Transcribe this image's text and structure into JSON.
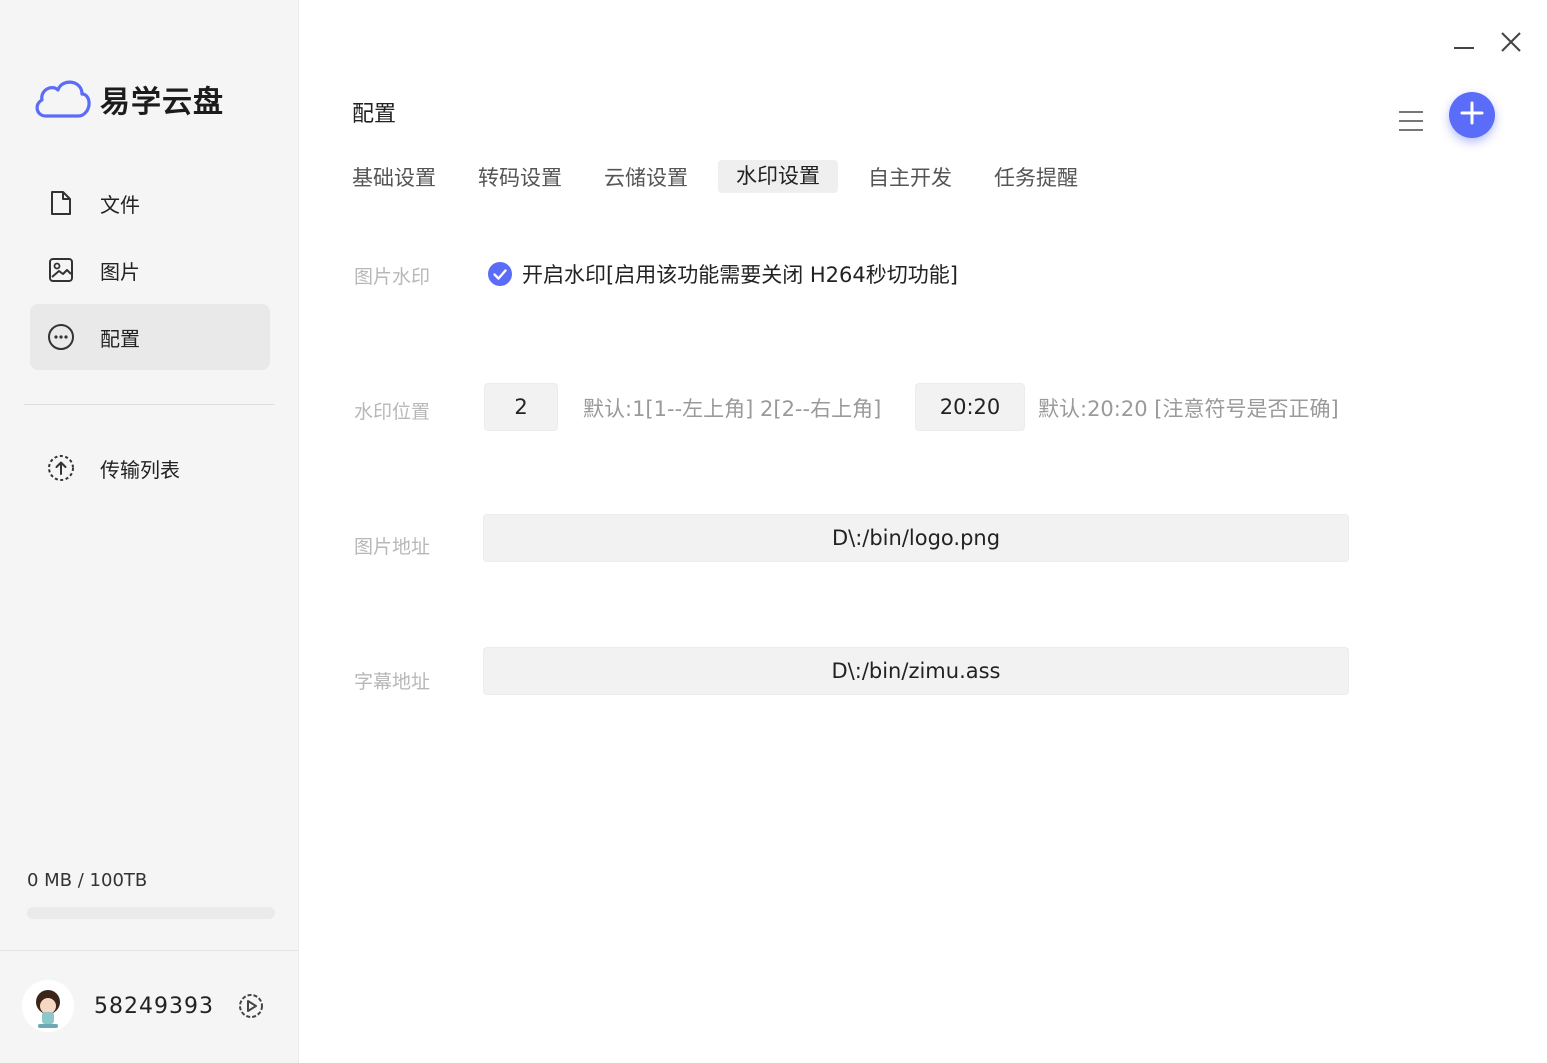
{
  "app": {
    "name": "易学云盘"
  },
  "sidebar": {
    "items": [
      {
        "label": "文件",
        "icon": "file-icon"
      },
      {
        "label": "图片",
        "icon": "image-icon"
      },
      {
        "label": "配置",
        "icon": "more-circle-icon",
        "active": true
      },
      {
        "label": "传输列表",
        "icon": "upload-circle-icon"
      }
    ],
    "storage": {
      "text": "0 MB / 100TB",
      "used_fraction": 0
    },
    "user": {
      "id": "58249393"
    }
  },
  "header": {
    "title": "配置"
  },
  "tabs": [
    {
      "label": "基础设置"
    },
    {
      "label": "转码设置"
    },
    {
      "label": "云储设置"
    },
    {
      "label": "水印设置",
      "active": true
    },
    {
      "label": "自主开发"
    },
    {
      "label": "任务提醒"
    }
  ],
  "watermark": {
    "enable": {
      "label": "图片水印",
      "checked": true,
      "text": "开启水印[启用该功能需要关闭 H264秒切功能]"
    },
    "position": {
      "label": "水印位置",
      "value": "2",
      "hint": "默认:1[1--左上角] 2[2--右上角]",
      "offset_value": "20:20",
      "offset_hint": "默认:20:20 [注意符号是否正确]"
    },
    "image_path": {
      "label": "图片地址",
      "value": "D\\:/bin/logo.png"
    },
    "subtitle_path": {
      "label": "字幕地址",
      "value": "D\\:/bin/zimu.ass"
    }
  },
  "colors": {
    "accent": "#5b6cf9",
    "sidebar_bg": "#f5f5f5",
    "active_bg": "#e9e9e9"
  }
}
